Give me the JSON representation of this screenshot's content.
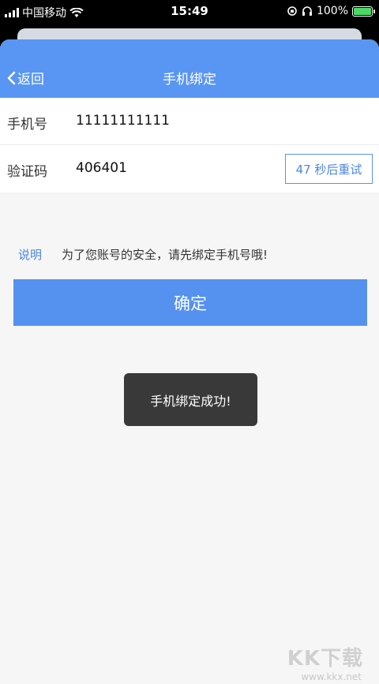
{
  "status_bar": {
    "carrier": "中国移动",
    "time": "15:49",
    "battery": "100%",
    "battery_color": "#4cd964"
  },
  "nav": {
    "back_label": "返回",
    "title": "手机绑定",
    "color": "#5996f3"
  },
  "form": {
    "phone_label": "手机号",
    "phone_value": "11111111111",
    "code_label": "验证码",
    "code_value": "406401",
    "retry_label": "47 秒后重试"
  },
  "note": {
    "label": "说明",
    "text": "为了您账号的安全，请先绑定手机号哦!"
  },
  "confirm_label": "确定",
  "toast": "手机绑定成功!",
  "watermark": {
    "logo": "KK下载",
    "url": "www.kkx.net"
  }
}
